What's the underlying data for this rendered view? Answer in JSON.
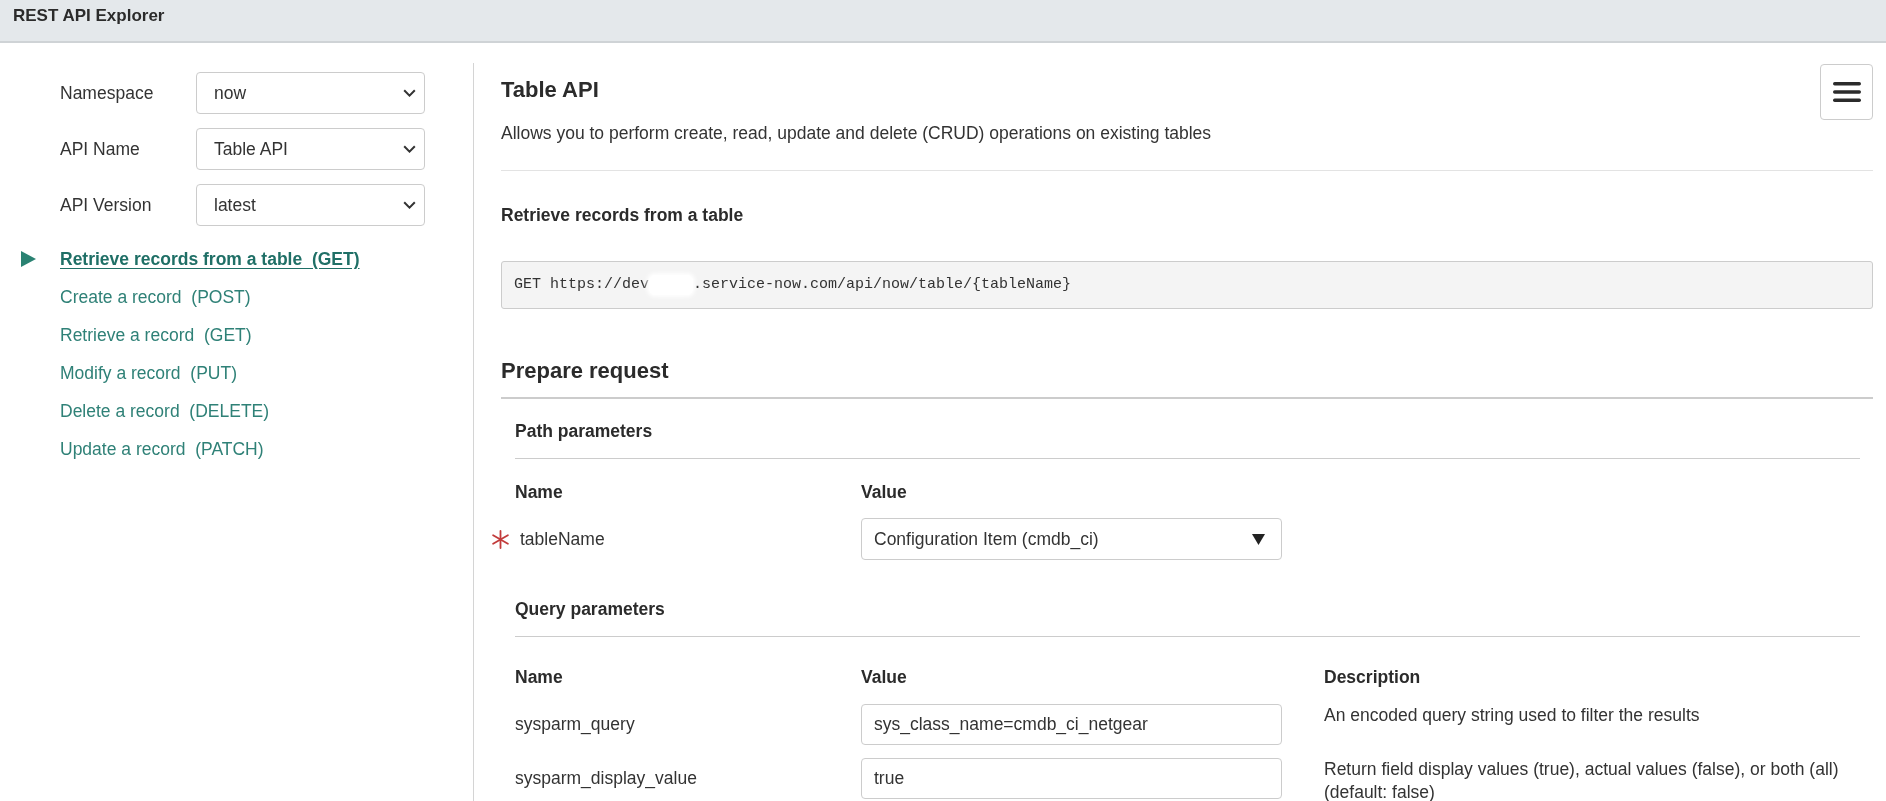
{
  "header": {
    "title": "REST API Explorer"
  },
  "sidebar": {
    "fields": [
      {
        "label": "Namespace",
        "value": "now"
      },
      {
        "label": "API Name",
        "value": "Table API"
      },
      {
        "label": "API Version",
        "value": "latest"
      }
    ],
    "methods": [
      {
        "label": "Retrieve records from a table  (GET)",
        "selected": true
      },
      {
        "label": "Create a record  (POST)",
        "selected": false
      },
      {
        "label": "Retrieve a record  (GET)",
        "selected": false
      },
      {
        "label": "Modify a record  (PUT)",
        "selected": false
      },
      {
        "label": "Delete a record  (DELETE)",
        "selected": false
      },
      {
        "label": "Update a record  (PATCH)",
        "selected": false
      }
    ]
  },
  "main": {
    "title": "Table API",
    "description": "Allows you to perform create, read, update and delete (CRUD) operations on existing tables",
    "operation": {
      "title": "Retrieve records from a table",
      "url_start": "GET https://dev",
      "url_end": ".service-now.com/api/now/table/{tableName}"
    },
    "prepare_request": {
      "title": "Prepare request",
      "sections": [
        {
          "title": "Path parameters",
          "columns": [
            "Name",
            "Value"
          ],
          "rows": [
            {
              "name": "tableName",
              "required": true,
              "kind": "select",
              "value": "Configuration Item (cmdb_ci)"
            }
          ]
        },
        {
          "title": "Query parameters",
          "columns": [
            "Name",
            "Value",
            "Description"
          ],
          "rows": [
            {
              "name": "sysparm_query",
              "required": false,
              "kind": "text",
              "value": "sys_class_name=cmdb_ci_netgear",
              "description": "An encoded query string used to filter the results"
            },
            {
              "name": "sysparm_display_value",
              "required": false,
              "kind": "text",
              "value": "true",
              "description": "Return field display values (true), actual values (false), or both (all) (default: false)"
            }
          ]
        }
      ]
    }
  }
}
